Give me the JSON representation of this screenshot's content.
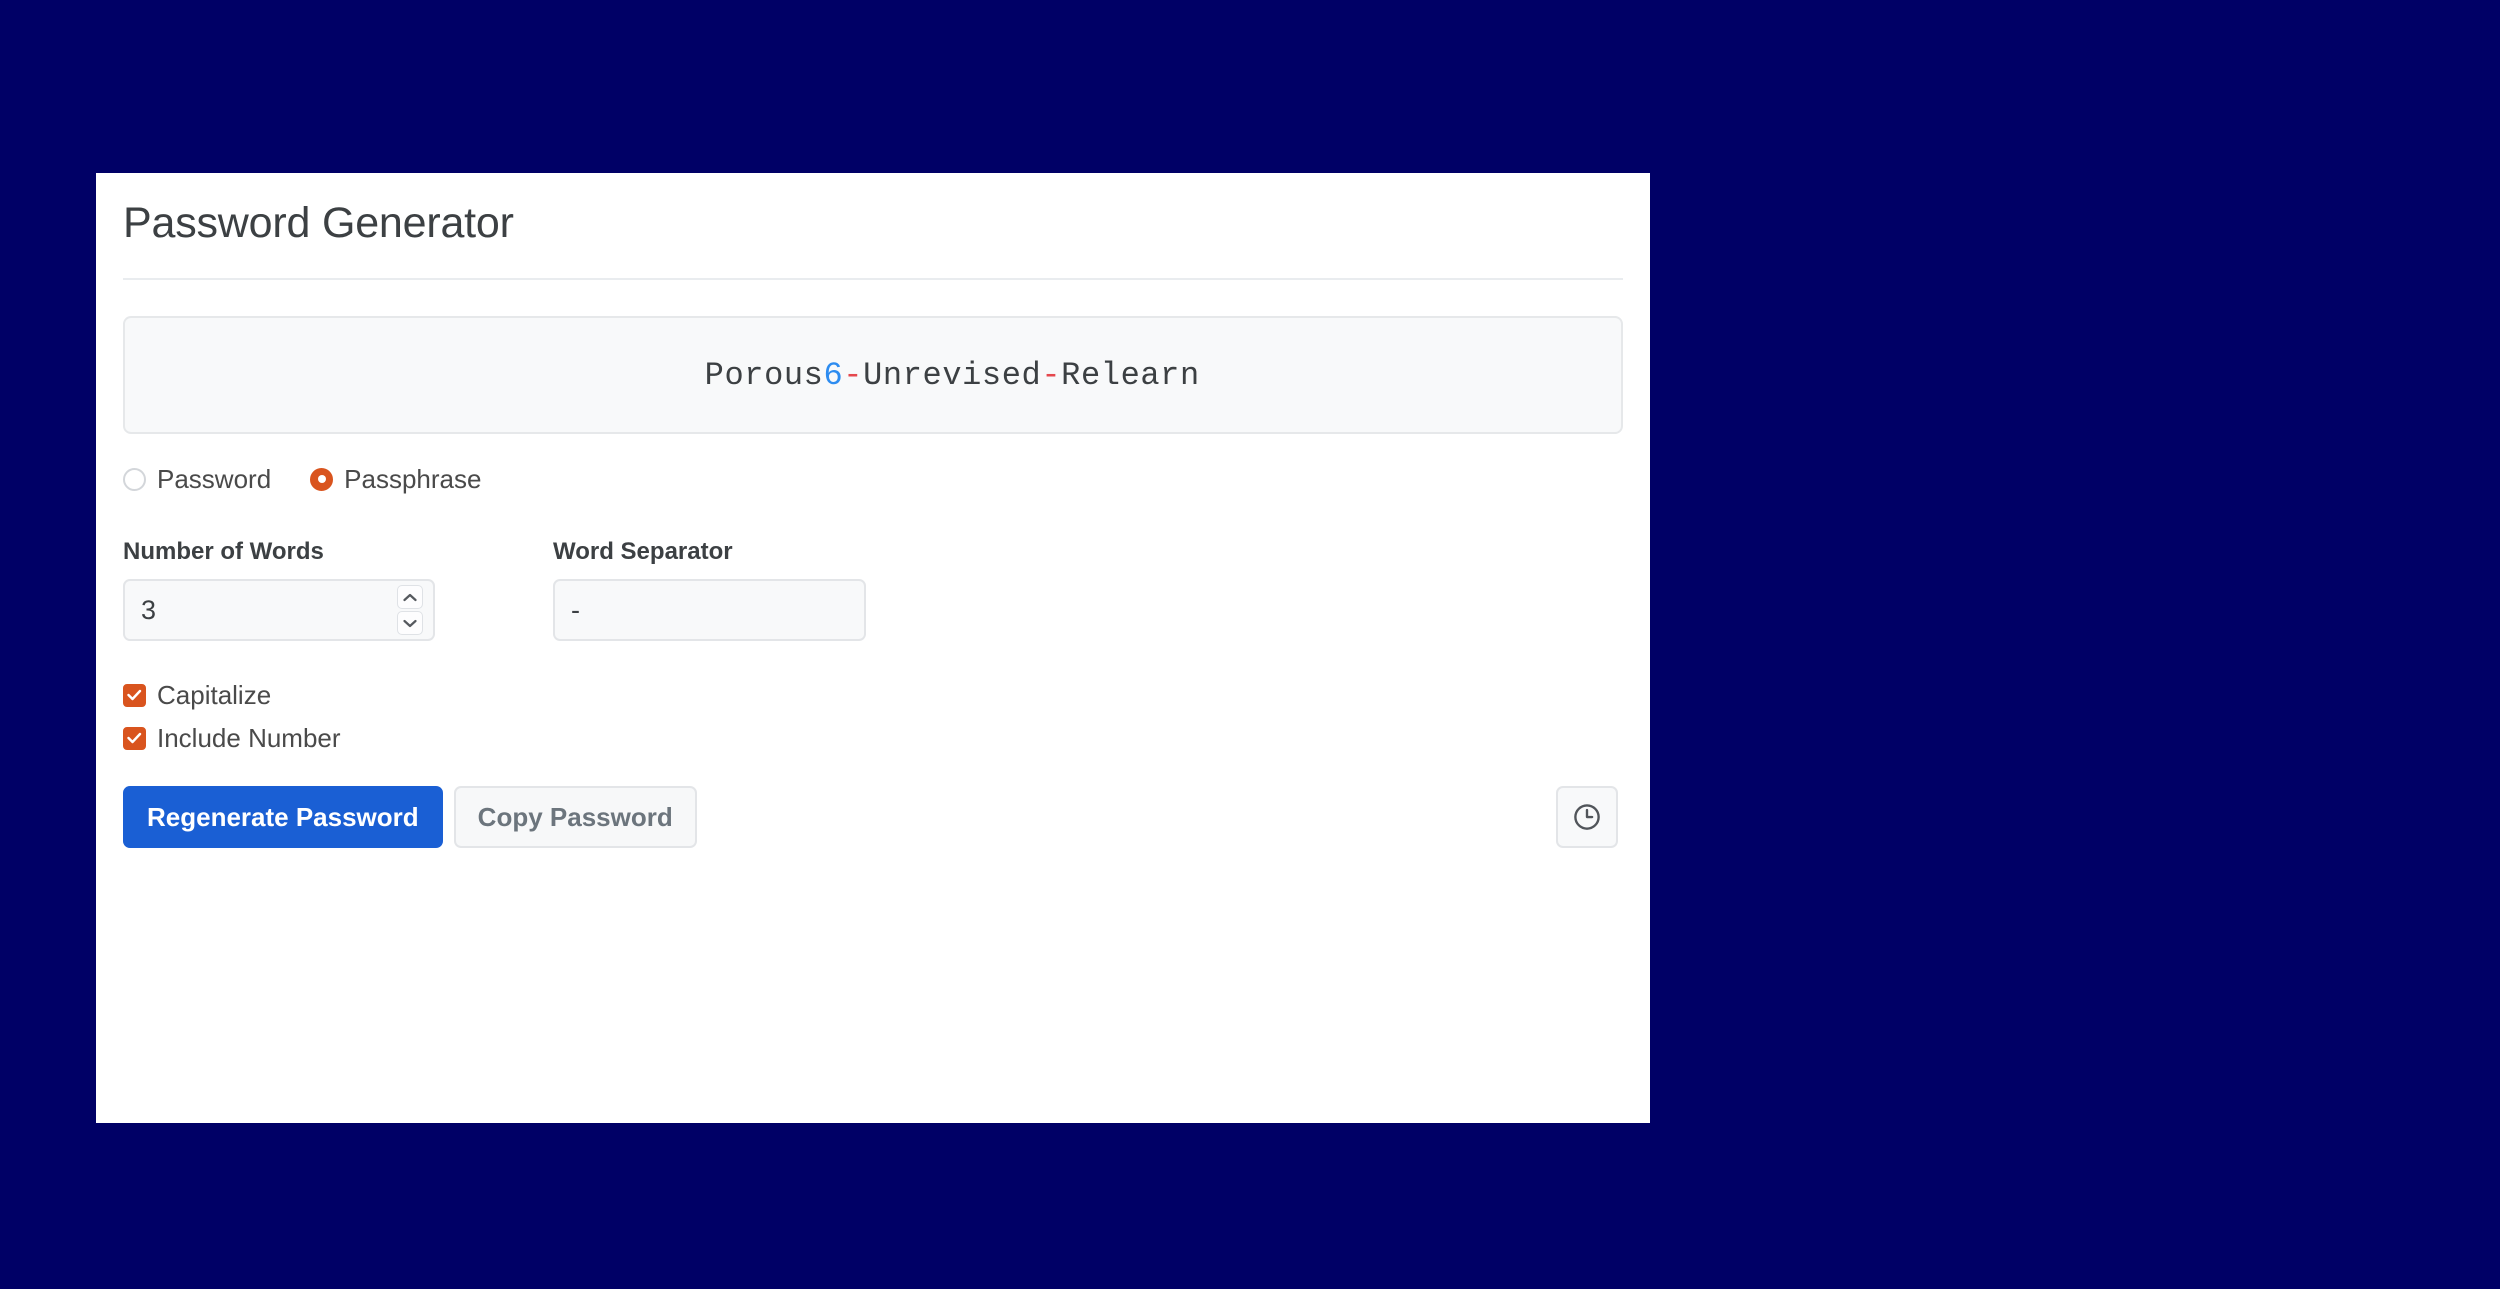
{
  "app": {
    "background_color": "#000066",
    "card_background": "#ffffff",
    "title": "Password Generator"
  },
  "password_display": {
    "full_value": "Porous6-Unrevised-Relearn",
    "segments": [
      {
        "text": "Porous",
        "kind": "word"
      },
      {
        "text": "6",
        "kind": "digit"
      },
      {
        "text": "-",
        "kind": "separator"
      },
      {
        "text": "Unrevised",
        "kind": "word"
      },
      {
        "text": "-",
        "kind": "separator"
      },
      {
        "text": "Relearn",
        "kind": "word"
      }
    ],
    "word_color": "#3c4043",
    "digit_color": "#2d8cf0",
    "separator_color": "#e5484d"
  },
  "type_selector": {
    "options": [
      {
        "label": "Password",
        "selected": false
      },
      {
        "label": "Passphrase",
        "selected": true
      }
    ],
    "accent_color": "#d9541e"
  },
  "fields": {
    "number_of_words": {
      "label": "Number of Words",
      "value": "3",
      "spinner_up_icon": "chevron-up-icon",
      "spinner_down_icon": "chevron-down-icon"
    },
    "word_separator": {
      "label": "Word Separator",
      "value": "-"
    }
  },
  "checkboxes": [
    {
      "label": "Capitalize",
      "checked": true
    },
    {
      "label": "Include Number",
      "checked": true
    }
  ],
  "buttons": {
    "regenerate": {
      "label": "Regenerate Password",
      "color": "#1a5fd4",
      "text_color": "#ffffff"
    },
    "copy": {
      "label": "Copy Password",
      "color": "#f7f8f9",
      "text_color": "#6c757d"
    },
    "history": {
      "icon": "clock-icon",
      "label": ""
    }
  }
}
